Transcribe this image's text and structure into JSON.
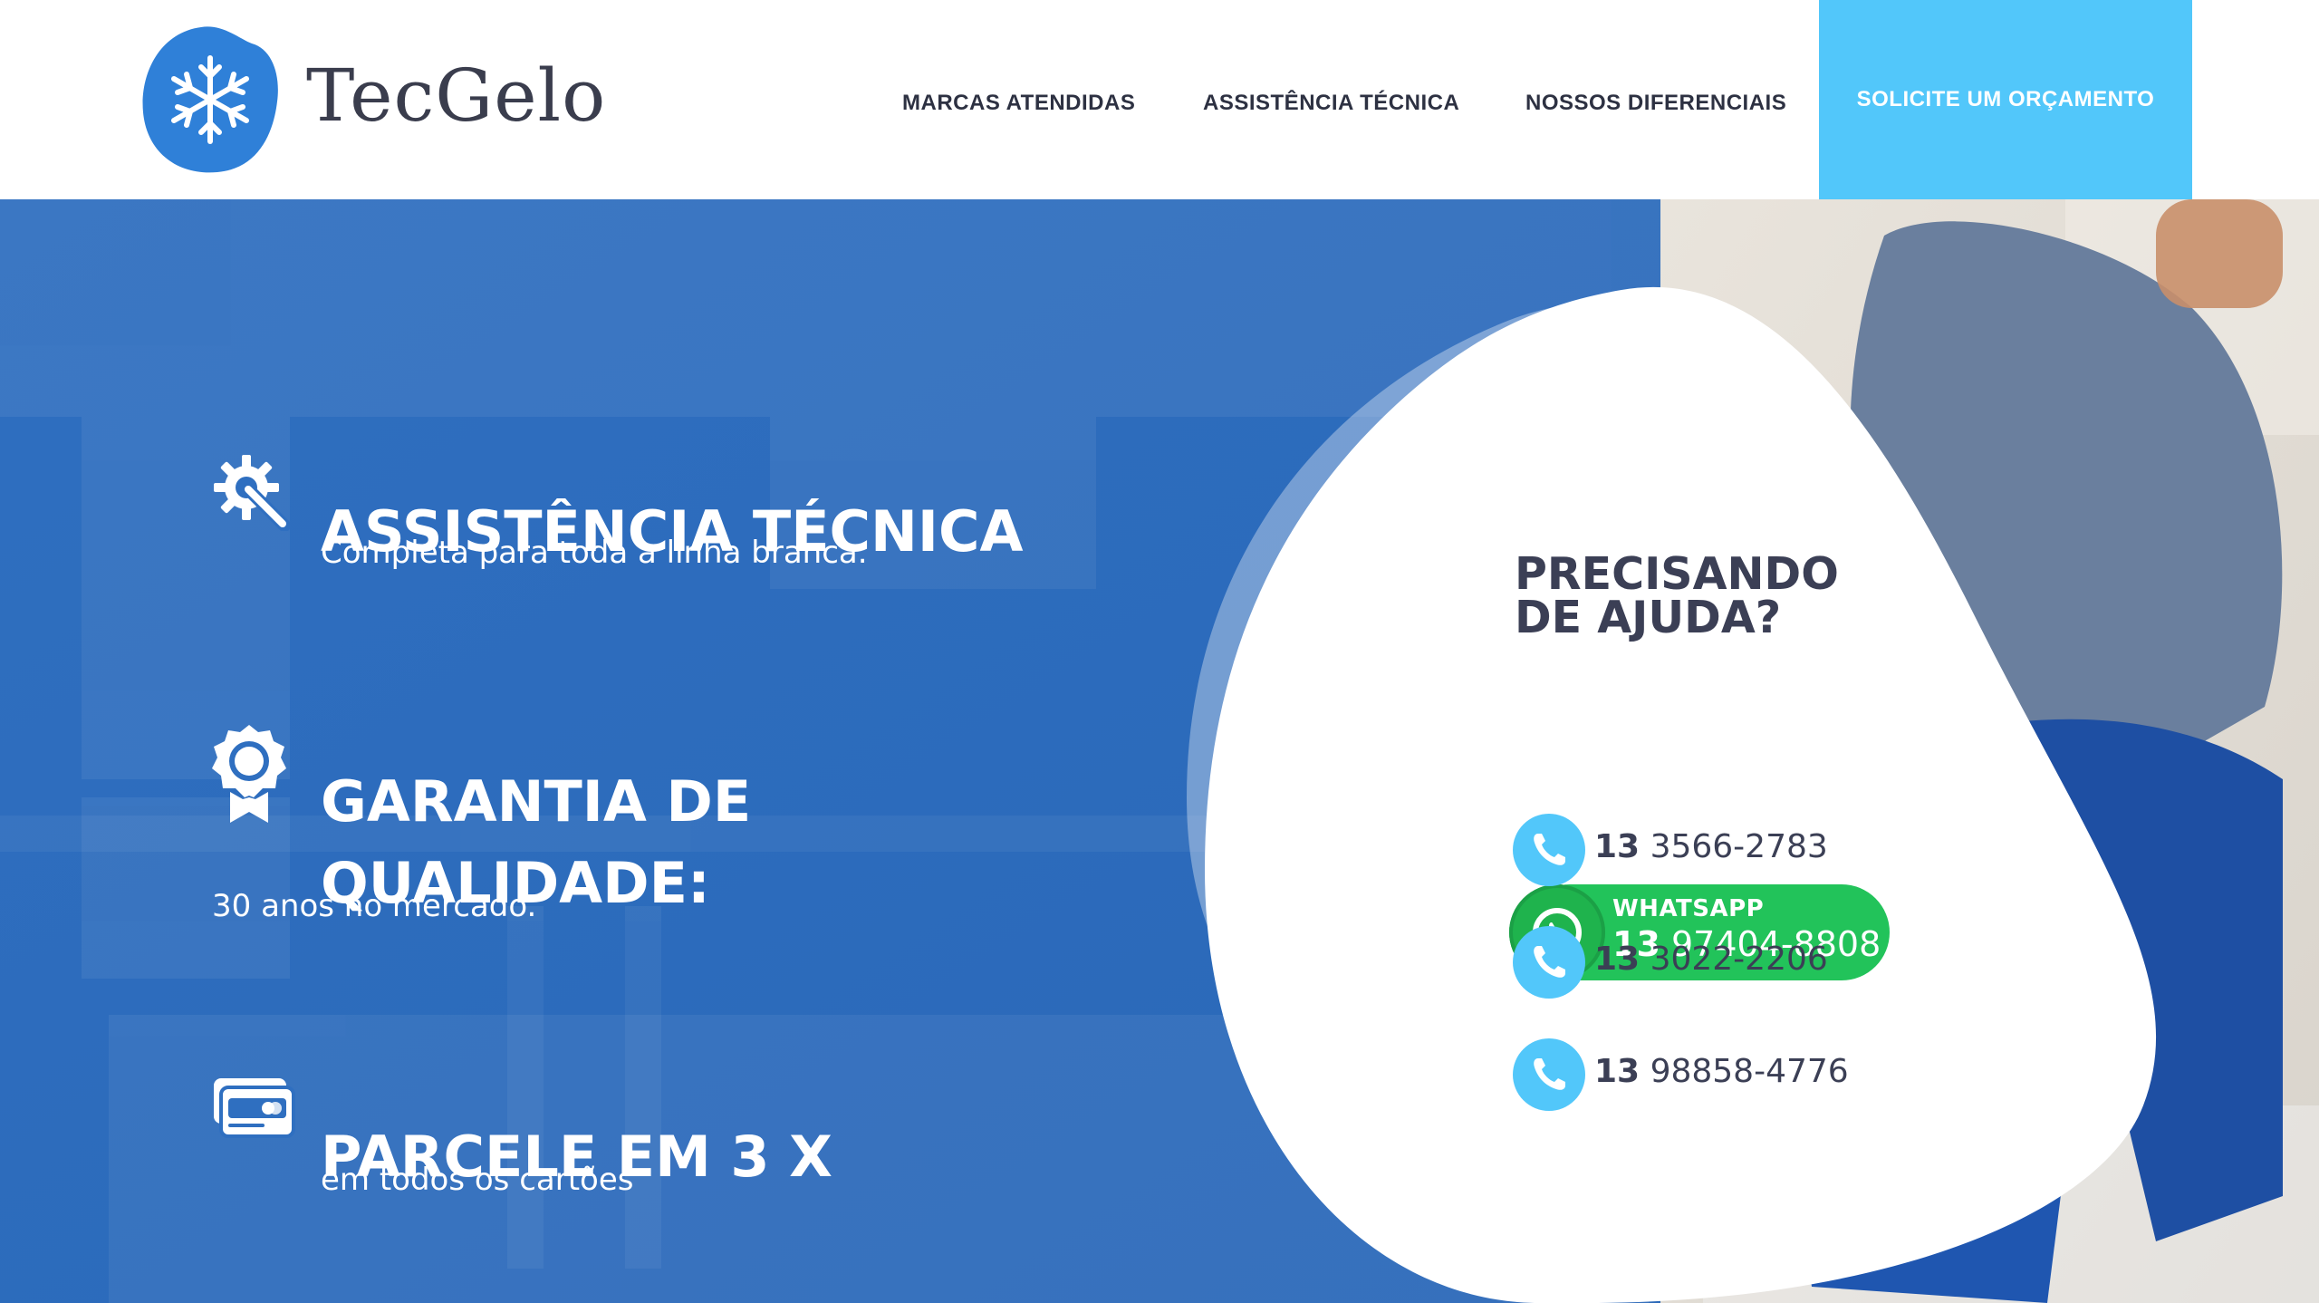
{
  "brand": {
    "name": "TecGelo",
    "colors": {
      "primary_blue": "#2f6fc0",
      "accent_cyan": "#52c7fa",
      "whatsapp_green": "#22c35a",
      "dark_text": "#3b3f55"
    }
  },
  "nav": {
    "items": [
      {
        "label": "MARCAS ATENDIDAS"
      },
      {
        "label": "ASSISTÊNCIA TÉCNICA"
      },
      {
        "label": "NOSSOS DIFERENCIAIS"
      }
    ],
    "cta_label": "SOLICITE UM ORÇAMENTO"
  },
  "features": [
    {
      "icon": "gear-wrench-icon",
      "title": "ASSISTÊNCIA TÉCNICA",
      "subtitle": "Completa para toda a linha branca."
    },
    {
      "icon": "quality-badge-icon",
      "title_line1": "GARANTIA DE",
      "title_line2": "QUALIDADE:",
      "subtitle": "30 anos no mercado."
    },
    {
      "icon": "credit-cards-icon",
      "title": "PARCELE EM 3 X",
      "subtitle": "em todos os cartões"
    }
  ],
  "help": {
    "title_line1": "PRECISANDO",
    "title_line2": "DE AJUDA?",
    "whatsapp": {
      "label": "WHATSAPP",
      "ddd": "13",
      "number": "97404-8808"
    },
    "phones": [
      {
        "ddd": "13",
        "number": "3566-2783"
      },
      {
        "ddd": "13",
        "number": "3022-2206"
      },
      {
        "ddd": "13",
        "number": "98858-4776"
      }
    ]
  }
}
